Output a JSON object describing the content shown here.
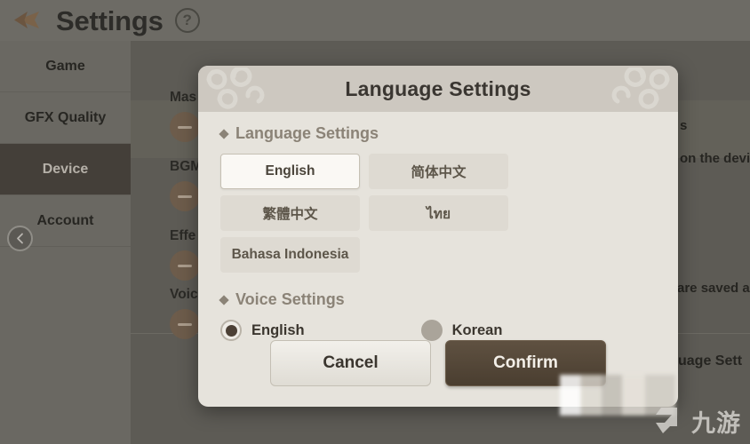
{
  "background": {
    "title": "Settings",
    "back_icon": "back-arrow-icon",
    "help_icon": "help-question-icon",
    "collapse_icon": "chevron-left-icon",
    "nav": {
      "items": [
        {
          "label": "Game",
          "active": false
        },
        {
          "label": "GFX Quality",
          "active": false
        },
        {
          "label": "Device",
          "active": true
        },
        {
          "label": "Account",
          "active": false
        }
      ]
    },
    "volume_rows": [
      {
        "label": "Mas"
      },
      {
        "label": "BGM"
      },
      {
        "label": "Effe"
      },
      {
        "label": "Voic"
      }
    ],
    "right_fragments": [
      {
        "text": "s"
      },
      {
        "text": "on the devi"
      },
      {
        "text": "are saved a"
      },
      {
        "text": "uage Sett"
      }
    ]
  },
  "modal": {
    "title": "Language Settings",
    "language_section": {
      "heading": "Language Settings",
      "options": [
        {
          "label": "English",
          "selected": true
        },
        {
          "label": "简体中文",
          "selected": false
        },
        {
          "label": "繁體中文",
          "selected": false
        },
        {
          "label": "ไทย",
          "selected": false
        },
        {
          "label": "Bahasa Indonesia",
          "selected": false
        }
      ]
    },
    "voice_section": {
      "heading": "Voice Settings",
      "options": [
        {
          "label": "English",
          "selected": true
        },
        {
          "label": "Korean",
          "selected": false
        }
      ]
    },
    "actions": {
      "cancel": "Cancel",
      "confirm": "Confirm"
    }
  },
  "watermark": {
    "text": "九游",
    "logo_icon": "jiuyou-logo-icon"
  },
  "colors": {
    "modal_bg": "#e6e3dc",
    "modal_header": "#cdc8c0",
    "confirm_brown": "#4f4335",
    "selected_border": "#c6c0b4",
    "heading_gray": "#8b8377",
    "overlay_dim": "#5d5b55"
  }
}
